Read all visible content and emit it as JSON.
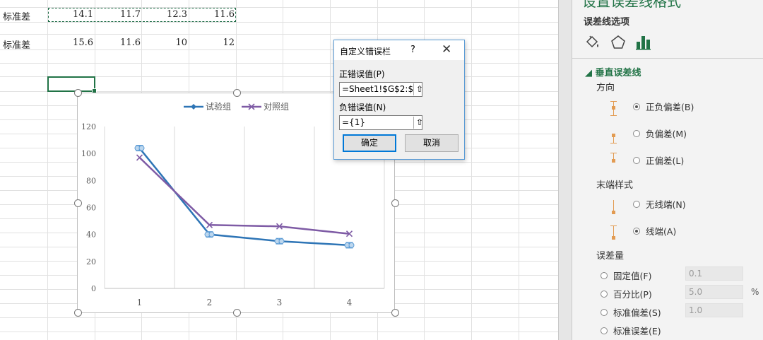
{
  "sheet": {
    "row1": {
      "label": "标准差",
      "values": [
        "14.1",
        "11.7",
        "12.3",
        "11.6"
      ]
    },
    "row2": {
      "label": "标准差",
      "values": [
        "15.6",
        "11.6",
        "10",
        "12"
      ]
    }
  },
  "chart_data": {
    "type": "line",
    "categories": [
      "1",
      "2",
      "3",
      "4"
    ],
    "series": [
      {
        "name": "试验组",
        "values": [
          104,
          40,
          35,
          32
        ],
        "color": "#2e75b6"
      },
      {
        "name": "对照组",
        "values": [
          97,
          47,
          46,
          40.5
        ],
        "color": "#7e5ba5"
      }
    ],
    "ylim": [
      0,
      120
    ],
    "yticks": [
      "0",
      "20",
      "40",
      "60",
      "80",
      "100",
      "120"
    ],
    "grid": "vertical-category-lines",
    "legend": "top",
    "error_bars": "both"
  },
  "dialog": {
    "title": "自定义错误栏",
    "help": "?",
    "close": "✕",
    "pos_label": "正错误值(P)",
    "pos_value": "=Sheet1!$G$2:$",
    "neg_label": "负错误值(N)",
    "neg_value": "={1}",
    "ok": "确定",
    "cancel": "取消"
  },
  "panel": {
    "title": "设置误差线格式",
    "subtitle": "误差线选项",
    "tab_icons": [
      "fill-line-icon",
      "effects-icon",
      "bar-chart-icon"
    ],
    "section": "垂直误差线",
    "direction_label": "方向",
    "direction_options": [
      {
        "label": "正负偏差(B)",
        "selected": true
      },
      {
        "label": "负偏差(M)",
        "selected": false
      },
      {
        "label": "正偏差(L)",
        "selected": false
      }
    ],
    "endstyle_label": "末端样式",
    "endstyle_options": [
      {
        "label": "无线端(N)",
        "selected": false
      },
      {
        "label": "线端(A)",
        "selected": true
      }
    ],
    "amount_label": "误差量",
    "amount_options": [
      {
        "label": "固定值(F)",
        "value": "0.1"
      },
      {
        "label": "百分比(P)",
        "value": "5.0",
        "unit": "%"
      },
      {
        "label": "标准偏差(S)",
        "value": "1.0"
      },
      {
        "label": "标准误差(E)",
        "value": ""
      }
    ],
    "colors": {
      "accent": "#217346"
    }
  }
}
